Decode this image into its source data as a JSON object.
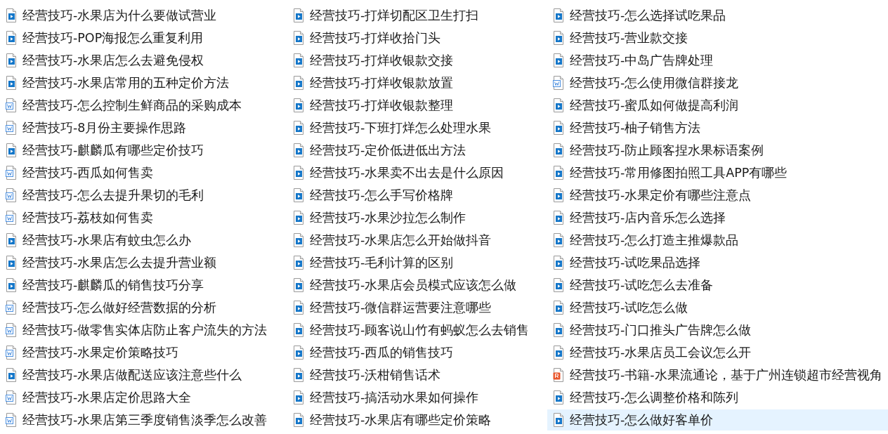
{
  "files": [
    {
      "name": "经营技巧-水果店为什么要做试营业",
      "kind": "video",
      "selected": false
    },
    {
      "name": "经营技巧-POP海报怎么重复利用",
      "kind": "video",
      "selected": false
    },
    {
      "name": "经营技巧-水果店怎么去避免侵权",
      "kind": "video",
      "selected": false
    },
    {
      "name": "经营技巧-水果店常用的五种定价方法",
      "kind": "video",
      "selected": false
    },
    {
      "name": "经营技巧-怎么控制生鲜商品的采购成本",
      "kind": "doc",
      "selected": false
    },
    {
      "name": "经营技巧-8月份主要操作思路",
      "kind": "doc",
      "selected": false
    },
    {
      "name": "经营技巧-麒麟瓜有哪些定价技巧",
      "kind": "video",
      "selected": false
    },
    {
      "name": "经营技巧-西瓜如何售卖",
      "kind": "doc",
      "selected": false
    },
    {
      "name": "经营技巧-怎么去提升果切的毛利",
      "kind": "doc",
      "selected": false
    },
    {
      "name": "经营技巧-荔枝如何售卖",
      "kind": "doc",
      "selected": false
    },
    {
      "name": "经营技巧-水果店有蚊虫怎么办",
      "kind": "video",
      "selected": false
    },
    {
      "name": "经营技巧-水果店怎么去提升营业额",
      "kind": "video",
      "selected": false
    },
    {
      "name": "经营技巧-麒麟瓜的销售技巧分享",
      "kind": "video",
      "selected": false
    },
    {
      "name": "经营技巧-怎么做好经营数据的分析",
      "kind": "doc",
      "selected": false
    },
    {
      "name": "经营技巧-做零售实体店防止客户流失的方法",
      "kind": "doc",
      "selected": false
    },
    {
      "name": "经营技巧-水果定价策略技巧",
      "kind": "doc",
      "selected": false
    },
    {
      "name": "经营技巧-水果店做配送应该注意些什么",
      "kind": "video",
      "selected": false
    },
    {
      "name": "经营技巧-水果店定价思路大全",
      "kind": "doc",
      "selected": false
    },
    {
      "name": "经营技巧-水果店第三季度销售淡季怎么改善",
      "kind": "doc",
      "selected": false
    },
    {
      "name": "经营技巧-打烊切配区卫生打扫",
      "kind": "video",
      "selected": false
    },
    {
      "name": "经营技巧-打烊收拾门头",
      "kind": "video",
      "selected": false
    },
    {
      "name": "经营技巧-打烊收银款交接",
      "kind": "video",
      "selected": false
    },
    {
      "name": "经营技巧-打烊收银款放置",
      "kind": "video",
      "selected": false
    },
    {
      "name": "经营技巧-打烊收银款整理",
      "kind": "video",
      "selected": false
    },
    {
      "name": "经营技巧-下班打烊怎么处理水果",
      "kind": "video",
      "selected": false
    },
    {
      "name": "经营技巧-定价低进低出方法",
      "kind": "video",
      "selected": false
    },
    {
      "name": "经营技巧-水果卖不出去是什么原因",
      "kind": "video",
      "selected": false
    },
    {
      "name": "经营技巧-怎么手写价格牌",
      "kind": "video",
      "selected": false
    },
    {
      "name": "经营技巧-水果沙拉怎么制作",
      "kind": "video",
      "selected": false
    },
    {
      "name": "经营技巧-水果店怎么开始做抖音",
      "kind": "video",
      "selected": false
    },
    {
      "name": "经营技巧-毛利计算的区别",
      "kind": "video",
      "selected": false
    },
    {
      "name": "经营技巧-水果店会员模式应该怎么做",
      "kind": "video",
      "selected": false
    },
    {
      "name": "经营技巧-微信群运营要注意哪些",
      "kind": "video",
      "selected": false
    },
    {
      "name": "经营技巧-顾客说山竹有蚂蚁怎么去销售",
      "kind": "video",
      "selected": false
    },
    {
      "name": "经营技巧-西瓜的销售技巧",
      "kind": "video",
      "selected": false
    },
    {
      "name": "经营技巧-沃柑销售话术",
      "kind": "video",
      "selected": false
    },
    {
      "name": "经营技巧-搞活动水果如何操作",
      "kind": "video",
      "selected": false
    },
    {
      "name": "经营技巧-水果店有哪些定价策略",
      "kind": "video",
      "selected": false
    },
    {
      "name": "经营技巧-怎么选择试吃果品",
      "kind": "video",
      "selected": false
    },
    {
      "name": "经营技巧-营业款交接",
      "kind": "video",
      "selected": false
    },
    {
      "name": "经营技巧-中岛广告牌处理",
      "kind": "video",
      "selected": false
    },
    {
      "name": "经营技巧-怎么使用微信群接龙",
      "kind": "doc",
      "selected": false
    },
    {
      "name": "经营技巧-蜜瓜如何做提高利润",
      "kind": "video",
      "selected": false
    },
    {
      "name": "经营技巧-柚子销售方法",
      "kind": "video",
      "selected": false
    },
    {
      "name": "经营技巧-防止顾客捏水果标语案例",
      "kind": "video",
      "selected": false
    },
    {
      "name": "经营技巧-常用修图拍照工具APP有哪些",
      "kind": "video",
      "selected": false
    },
    {
      "name": "经营技巧-水果定价有哪些注意点",
      "kind": "video",
      "selected": false
    },
    {
      "name": "经营技巧-店内音乐怎么选择",
      "kind": "video",
      "selected": false
    },
    {
      "name": "经营技巧-怎么打造主推爆款品",
      "kind": "video",
      "selected": false
    },
    {
      "name": "经营技巧-试吃果品选择",
      "kind": "video",
      "selected": false
    },
    {
      "name": "经营技巧-试吃怎么去准备",
      "kind": "video",
      "selected": false
    },
    {
      "name": "经营技巧-试吃怎么做",
      "kind": "video",
      "selected": false
    },
    {
      "name": "经营技巧-门口推头广告牌怎么做",
      "kind": "video",
      "selected": false
    },
    {
      "name": "经营技巧-水果店员工会议怎么开",
      "kind": "video",
      "selected": false
    },
    {
      "name": "经营技巧-书籍-水果流通论，基于广州连锁超市经营视角",
      "kind": "pdf",
      "selected": false
    },
    {
      "name": "经营技巧-怎么调整价格和陈列",
      "kind": "video",
      "selected": false
    },
    {
      "name": "经营技巧-怎么做好客单价",
      "kind": "video",
      "selected": true
    }
  ]
}
